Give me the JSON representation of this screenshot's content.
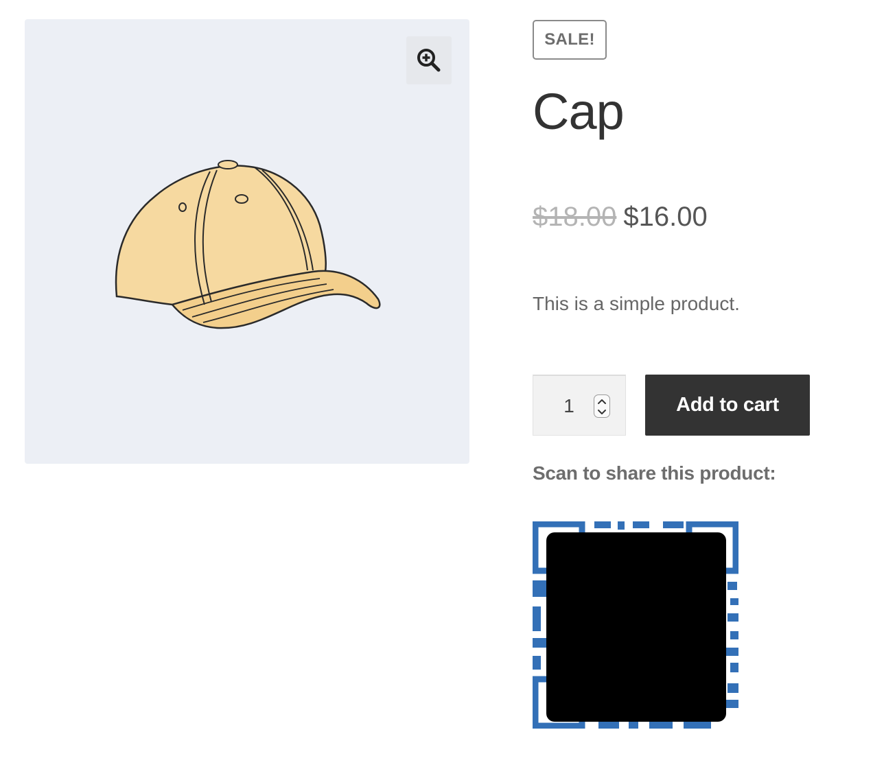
{
  "gallery": {
    "zoom_icon": "zoom-in-icon",
    "product_image": "cap-illustration"
  },
  "product": {
    "badge": "SALE!",
    "title": "Cap",
    "regular_price": "$18.00",
    "sale_price": "$16.00",
    "description": "This is a simple product."
  },
  "cart_form": {
    "quantity": "1",
    "add_to_cart_label": "Add to cart"
  },
  "share": {
    "label": "Scan to share this product:",
    "qr_color": "#3370b7"
  },
  "colors": {
    "button_bg": "#333333",
    "gallery_bg": "#eceff5",
    "cap_fill": "#f6d9a0"
  }
}
